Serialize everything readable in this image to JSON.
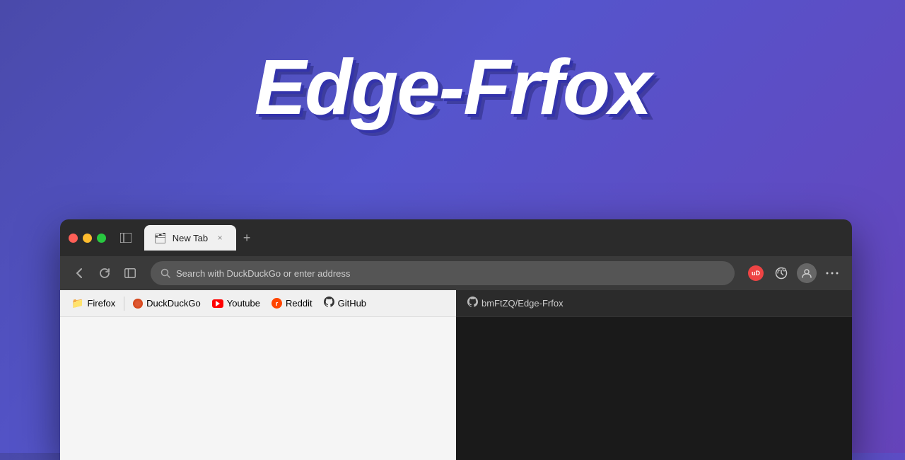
{
  "hero": {
    "title": "Edge-Frfox"
  },
  "browser": {
    "tab": {
      "icon": "🗂",
      "label": "New Tab",
      "close": "×"
    },
    "new_tab_btn": "+",
    "toolbar": {
      "back_icon": "‹",
      "refresh_icon": "↻",
      "sidebar_icon": "⊞",
      "address_placeholder": "Search with DuckDuckGo or enter address",
      "ublock_label": "uD",
      "more_icon": "···"
    },
    "bookmarks": [
      {
        "id": "firefox",
        "icon": "folder",
        "label": "Firefox"
      },
      {
        "id": "duckduckgo",
        "icon": "ddg",
        "label": "DuckDuckGo"
      },
      {
        "id": "youtube",
        "icon": "youtube",
        "label": "Youtube"
      },
      {
        "id": "reddit",
        "icon": "reddit",
        "label": "Reddit"
      },
      {
        "id": "github",
        "icon": "github",
        "label": "GitHub"
      },
      {
        "id": "edge-frfox",
        "icon": "github-dark",
        "label": "bmFtZQ/Edge-Frfox"
      }
    ]
  },
  "colors": {
    "bg_gradient_start": "#5050bb",
    "bg_gradient_end": "#6644cc",
    "titlebar": "#2b2b2b",
    "toolbar": "#3a3a3a",
    "bookmarks_light": "#f0f0f0",
    "bookmarks_dark": "#2b2b2b",
    "content_light": "#f5f5f5",
    "content_dark": "#1a1a1a"
  }
}
